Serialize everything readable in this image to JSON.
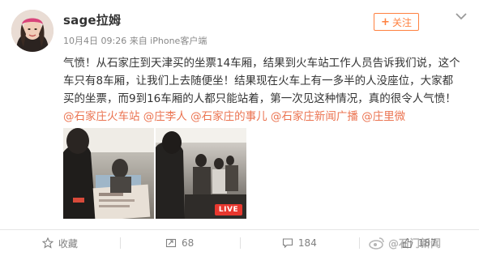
{
  "header": {
    "username": "sage拉姆",
    "meta": "10月4日 09:26 来自 iPhone客户端",
    "follow_label": "关注"
  },
  "post": {
    "text_plain": "气愤！从石家庄到天津买的坐票14车厢，结果到火车站工作人员告诉我们说，这个车只有8车厢，让我们上去随便坐！结果现在火车上有一多半的人没座位，大家都买的坐票，而9到16车厢的人都只能站着，第一次见这种情况，真的很令人气愤！",
    "tags": [
      "@石家庄火车站",
      "@庄李人",
      "@石家庄的事儿",
      "@石家庄新闻广播",
      "@庄里微"
    ]
  },
  "photos": [
    {
      "name": "photo-ticket"
    },
    {
      "name": "photo-train-aisle",
      "badge": "LIVE"
    }
  ],
  "actions": {
    "collect_label": "收藏",
    "repost_count": "68",
    "comment_count": "184",
    "like_count": "187"
  },
  "watermark": {
    "text": "@石门新闻"
  },
  "colors": {
    "accent": "#eb7350",
    "follow": "#ff8140",
    "live": "#e8382f"
  }
}
